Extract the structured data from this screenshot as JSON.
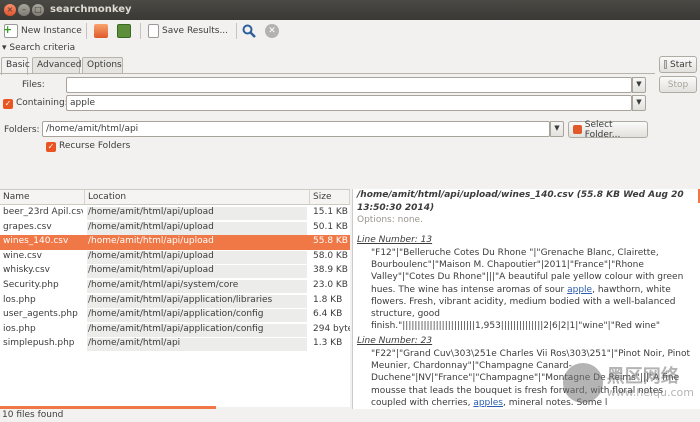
{
  "window": {
    "title": "searchmonkey"
  },
  "toolbar": {
    "new_instance": "New Instance",
    "save_results": "Save Results...",
    "icons": [
      "new-instance-icon",
      "open-folder-icon",
      "save-icon",
      "document-icon",
      "search-icon",
      "clear-icon"
    ]
  },
  "criteria": {
    "header": "Search criteria",
    "tabs": [
      "Basic",
      "Advanced",
      "Options"
    ],
    "files_label": "Files:",
    "files_value": "",
    "containing_label": "Containing:",
    "containing_value": "apple",
    "folders_label": "Folders:",
    "folders_value": "/home/amit/html/api",
    "select_folder": "Select Folder...",
    "recurse": "Recurse Folders",
    "start": "Start",
    "stop": "Stop"
  },
  "list": {
    "columns": [
      "Name",
      "Location",
      "Size"
    ],
    "rows": [
      {
        "name": "beer_23rd Apil.csv",
        "location": "/home/amit/html/api/upload",
        "size": "15.1 KB"
      },
      {
        "name": "grapes.csv",
        "location": "/home/amit/html/api/upload",
        "size": "50.1 KB"
      },
      {
        "name": "wines_140.csv",
        "location": "/home/amit/html/api/upload",
        "size": "55.8 KB"
      },
      {
        "name": "wine.csv",
        "location": "/home/amit/html/api/upload",
        "size": "58.0 KB"
      },
      {
        "name": "whisky.csv",
        "location": "/home/amit/html/api/upload",
        "size": "38.9 KB"
      },
      {
        "name": "Security.php",
        "location": "/home/amit/html/api/system/core",
        "size": "23.0 KB"
      },
      {
        "name": "los.php",
        "location": "/home/amit/html/api/application/libraries",
        "size": "1.8 KB"
      },
      {
        "name": "user_agents.php",
        "location": "/home/amit/html/api/application/config",
        "size": "6.4 KB"
      },
      {
        "name": "ios.php",
        "location": "/home/amit/html/api/application/config",
        "size": "294 byte"
      },
      {
        "name": "simplepush.php",
        "location": "/home/amit/html/api",
        "size": "1.3 KB"
      }
    ]
  },
  "preview": {
    "header": "/home/amit/html/api/upload/wines_140.csv (55.8 KB Wed Aug 20 13:50:30 2014)",
    "options": "Options: none.",
    "line1_label": "Line Number: 13",
    "line1_a": "\"F12\"|\"Belleruche Cotes Du Rhone \"|\"Grenache Blanc, Clairette, Bourboulenc\"|\"Maison M. Chapoutier\"|2011|\"France\"|\"Rhone Valley\"|\"Cotes Du Rhone\"|||\"A beautiful pale yellow colour with green hues. The wine has intense aromas of sour ",
    "line1_hl": "apple",
    "line1_b": ", hawthorn, white flowers. Fresh, vibrant acidity, medium bodied with a well-balanced structure, good finish.\"||||||||||||||||||||||||1,953||||||||||||||2|6|2|1|\"wine\"|\"Red wine\"",
    "line2_label": "Line Number: 23",
    "line2_a": "\"F22\"|\"Grand Cuv\\303\\251e Charles Vii Ros\\303\\251\"|\"Pinot Noir, Pinot Meunier, Chardonnay\"|\"Champagne Canard-Duchene\"|NV|\"France\"|\"Champagne\"|\"Montagne De Reims\"|||\"A fine mousse that leads the bouquet is fresh forward, with floral notes coupled with cherries, ",
    "line2_hl": "apples",
    "line2_b": ", mineral notes. Some l"
  },
  "status": "10 files found",
  "watermark": {
    "text": "黑区网络",
    "url": "www.heiqu.com"
  },
  "colors": {
    "accent": "#f07746",
    "checkbox": "#e95420",
    "link": "#2a5db0"
  }
}
